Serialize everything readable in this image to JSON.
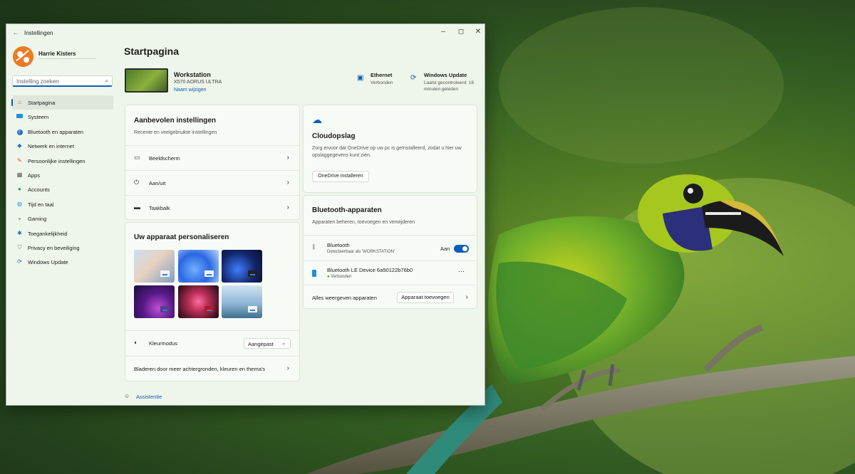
{
  "window": {
    "title": "Instellingen"
  },
  "profile": {
    "name": "Harrie Kisters"
  },
  "search": {
    "placeholder": "Instelling zoeken"
  },
  "sidebar": {
    "items": [
      {
        "label": "Startpagina",
        "icon": "home-icon"
      },
      {
        "label": "Systeem",
        "icon": "system-icon"
      },
      {
        "label": "Bluetooth en apparaten",
        "icon": "bluetooth-icon"
      },
      {
        "label": "Netwerk en internet",
        "icon": "network-icon"
      },
      {
        "label": "Persoonlijke instellingen",
        "icon": "brush-icon"
      },
      {
        "label": "Apps",
        "icon": "apps-icon"
      },
      {
        "label": "Accounts",
        "icon": "accounts-icon"
      },
      {
        "label": "Tijd en taal",
        "icon": "globe-icon"
      },
      {
        "label": "Gaming",
        "icon": "gaming-icon"
      },
      {
        "label": "Toegankelijkheid",
        "icon": "accessibility-icon"
      },
      {
        "label": "Privacy en beveiliging",
        "icon": "shield-icon"
      },
      {
        "label": "Windows Update",
        "icon": "update-icon"
      }
    ]
  },
  "main": {
    "title": "Startpagina",
    "device": {
      "name": "Workstation",
      "model": "X570 AORUS ULTRA",
      "rename": "Naam wijzigen"
    },
    "status": [
      {
        "title": "Ethernet",
        "sub": "Verbonden",
        "icon": "ethernet-icon"
      },
      {
        "title": "Windows Update",
        "sub": "Laatst gecontroleerd: 16 minuten geleden",
        "icon": "sync-icon"
      }
    ],
    "recommended": {
      "title": "Aanbevolen instellingen",
      "sub": "Recente en veelgebruikte instellingen",
      "rows": [
        {
          "label": "Beeldscherm",
          "icon": "display-icon"
        },
        {
          "label": "Aan/uit",
          "icon": "power-icon"
        },
        {
          "label": "Taakbalk",
          "icon": "taskbar-icon"
        }
      ]
    },
    "personalize": {
      "title": "Uw apparaat personaliseren",
      "color_mode_label": "Kleurmodus",
      "color_mode_value": "Aangepast",
      "more_link": "Bladeren door meer achtergronden, kleuren en thema's"
    },
    "cloud": {
      "title": "Cloudopslag",
      "desc": "Zorg ervoor dat OneDrive op uw pc is geïnstalleerd, zodat u hier uw opslaggegevens kunt zien.",
      "button": "OneDrive installeren"
    },
    "bluetooth": {
      "title": "Bluetooth-apparaten",
      "sub": "Apparaten beheren, toevoegen en verwijderen",
      "bt_label": "Bluetooth",
      "bt_sub": "Detecteerbaar als 'WORKSTATION'",
      "bt_state": "Aan",
      "bt_on": true,
      "device_name": "Bluetooth LE Device 6a50122b76b0",
      "device_status": "Verbonden",
      "more": "···",
      "show_all": "Alles weergeven apparaten",
      "add_button": "Apparaat toevoegen"
    },
    "help": "Assistentie"
  },
  "colors": {
    "accent": "#0a5db8",
    "avatar": "#ee7a22"
  }
}
